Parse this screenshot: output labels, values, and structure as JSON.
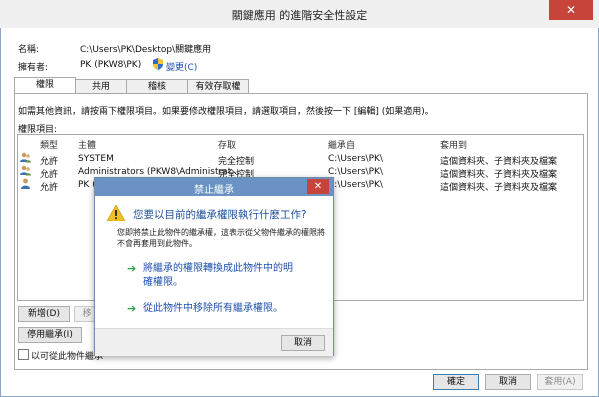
{
  "window": {
    "title": "關鍵應用 的進階安全性設定",
    "close_glyph": "✕"
  },
  "info": {
    "name_label": "名稱:",
    "name_value": "C:\\Users\\PK\\Desktop\\關鍵應用",
    "owner_label": "擁有者:",
    "owner_value": "PK (PKW8\\PK)",
    "change_link": "變更(C)"
  },
  "tabs": [
    "權限",
    "共用",
    "稽核",
    "有效存取權"
  ],
  "main": {
    "instructions": "如需其他資訊，請按兩下權限項目。如果要修改權限項目，請選取項目，然後按一下 [編輯] (如果適用)。",
    "entries_label": "權限項目:",
    "columns": [
      "類型",
      "主體",
      "存取",
      "繼承自",
      "套用到"
    ],
    "rows": [
      {
        "type": "允許",
        "principal": "SYSTEM",
        "access": "完全控制",
        "inherited": "C:\\Users\\PK\\",
        "applies": "這個資料夾、子資料夾及檔案"
      },
      {
        "type": "允許",
        "principal": "Administrators (PKW8\\Administrat...",
        "access": "完全控制",
        "inherited": "C:\\Users\\PK\\",
        "applies": "這個資料夾、子資料夾及檔案"
      },
      {
        "type": "允許",
        "principal": "PK (",
        "access": "",
        "inherited": "C:\\Users\\PK\\",
        "applies": "這個資料夾、子資料夾及檔案"
      }
    ],
    "add_button": "新增(D)",
    "remove_button": "移",
    "disable_inheritance_button": "停用繼承(I)",
    "replace_checkbox_label": "以可從此物件繼承"
  },
  "footer": {
    "ok": "確定",
    "cancel": "取消",
    "apply": "套用(A)"
  },
  "dialog": {
    "title": "禁止繼承",
    "close_glyph": "✕",
    "question": "您要以目前的繼承權限執行什麼工作?",
    "description": "您即將禁止此物件的繼承權，這表示從父物件繼承的權限將不會再套用到此物件。",
    "option1_line1": "將繼承的權限轉換成此物件中的明",
    "option1_line2": "確權限。",
    "option2": "從此物件中移除所有繼承權限。",
    "cancel": "取消"
  }
}
